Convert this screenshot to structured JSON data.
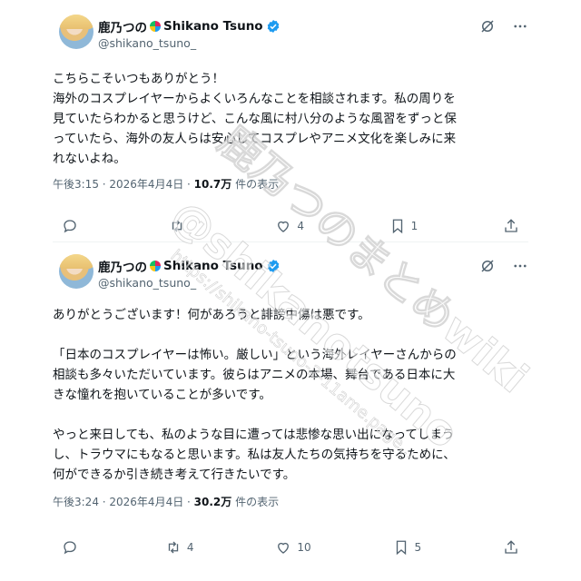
{
  "tweets": [
    {
      "name": "鹿乃つの",
      "name_latin": "Shikano Tsuno",
      "handle": "@shikano_tsuno_",
      "text": "こちらこそいつもありがとう！\n海外のコスプレイヤーからよくいろんなことを相談されます。私の周りを\n見ていたらわかると思うけど、こんな風に村八分のような風習をずっと保\nっていたら、海外の友人らは安心してコスプレやアニメ文化を楽しみに来\nれないよね。",
      "time": "午後3:15 · 2026年4月4日 · ",
      "views": "10.7万",
      "views_suffix": " 件の表示",
      "replies": "",
      "retweets": "",
      "likes": "4",
      "bookmarks": "1"
    },
    {
      "name": "鹿乃つの",
      "name_latin": "Shikano Tsuno",
      "handle": "@shikano_tsuno_",
      "text": "ありがとうございます！何があろうと誹謗中傷は悪です。\n\n「日本のコスプレイヤーは怖い。厳しい」という海外レイヤーさんからの\n相談も多々いただいています。彼らはアニメの本場、舞台である日本に大\nきな憧れを抱いていることが多いです。\n\nやっと来日しても、私のような目に遭っては悲惨な思い出になってしまう\nし、トラウマにもなると思います。私は友人たちの気持ちを守るために、\n何ができるか引き続き考えて行きたいです。",
      "time": "午後3:24 · 2026年4月4日 · ",
      "views": "30.2万",
      "views_suffix": " 件の表示",
      "replies": "",
      "retweets": "4",
      "likes": "10",
      "bookmarks": "5"
    }
  ],
  "watermark": {
    "main": "鹿乃つのまとめwiki",
    "handle": "@shikanotsuno",
    "url": "https://shikano-tsuno-2-11ame.page..."
  },
  "colors": {
    "verified": "#1d9bf0",
    "muted": "#536471",
    "text": "#0f1419"
  },
  "icons": [
    "grok-icon",
    "more-icon",
    "reply-icon",
    "retweet-icon",
    "like-icon",
    "bookmark-icon",
    "share-icon",
    "verified-icon"
  ]
}
